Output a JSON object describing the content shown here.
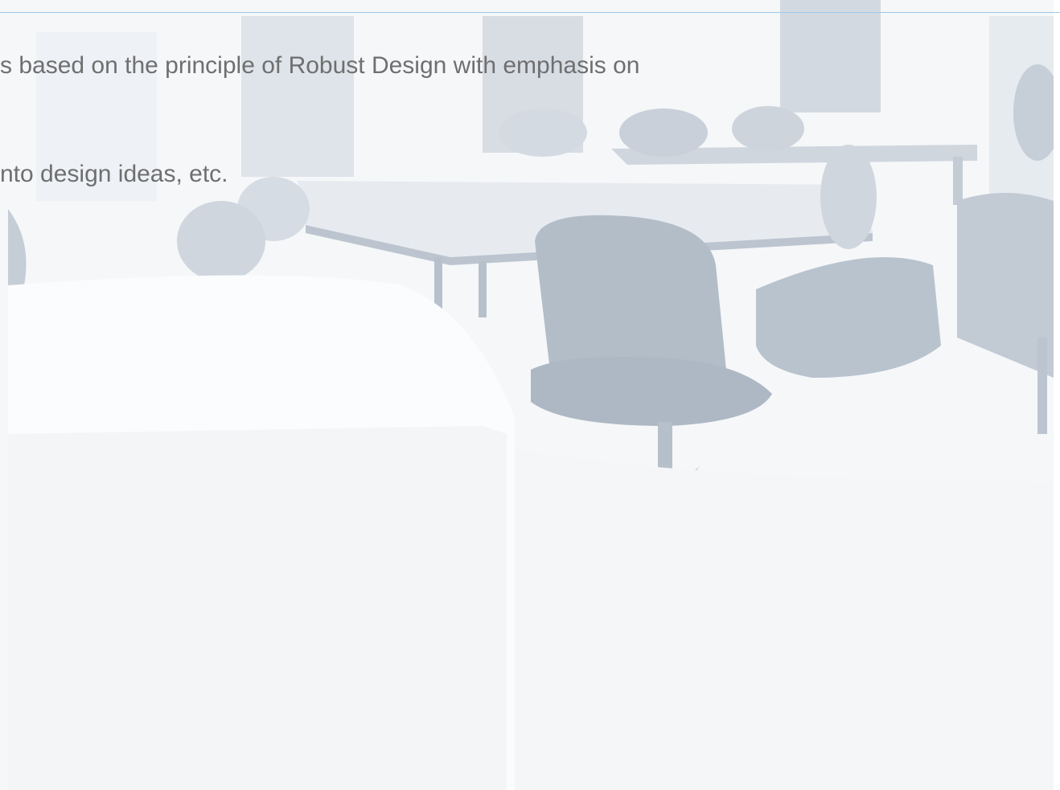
{
  "slide": {
    "text_lines": [
      "s based on the principle of Robust Design with emphasis on",
      "nto design ideas, etc."
    ],
    "text_color": "#6f6f70",
    "rule_color": "#9cc8ea"
  }
}
